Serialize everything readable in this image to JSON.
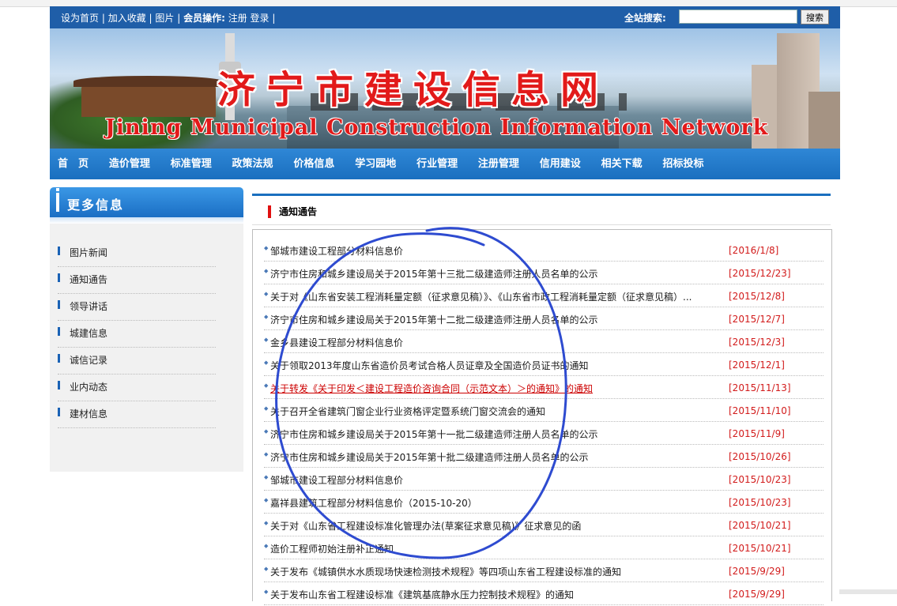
{
  "browser": {
    "bookmarks": [
      "",
      "",
      "",
      "",
      "",
      "",
      "",
      "",
      "",
      ""
    ]
  },
  "topbar": {
    "links": [
      "设为首页",
      "加入收藏",
      "图片"
    ],
    "member_label": "会员操作:",
    "member_links": [
      "注册",
      "登录"
    ],
    "search_label": "全站搜索:",
    "search_value": "",
    "search_button": "搜索"
  },
  "banner": {
    "title_cn": "济宁市建设信息网",
    "title_en": "Jining Municipal Construction Information Network"
  },
  "nav": {
    "items": [
      "首　页",
      "造价管理",
      "标准管理",
      "政策法规",
      "价格信息",
      "学习园地",
      "行业管理",
      "注册管理",
      "信用建设",
      "相关下载",
      "招标投标"
    ]
  },
  "sidebar": {
    "title": "更多信息",
    "items": [
      "图片新闻",
      "通知通告",
      "领导讲话",
      "城建信息",
      "诚信记录",
      "业内动态",
      "建材信息"
    ]
  },
  "main": {
    "title": "通知通告",
    "items": [
      {
        "title": "邹城市建设工程部分材料信息价",
        "date": "[2016/1/8]"
      },
      {
        "title": "济宁市住房和城乡建设局关于2015年第十三批二级建造师注册人员名单的公示",
        "date": "[2015/12/23]"
      },
      {
        "title": "关于对《山东省安装工程消耗量定额（征求意见稿）》、《山东省市政工程消耗量定额（征求意见稿）...",
        "date": "[2015/12/8]"
      },
      {
        "title": "济宁市住房和城乡建设局关于2015年第十二批二级建造师注册人员名单的公示",
        "date": "[2015/12/7]"
      },
      {
        "title": "金乡县建设工程部分材料信息价",
        "date": "[2015/12/3]"
      },
      {
        "title": "关于领取2013年度山东省造价员考试合格人员证章及全国造价员证书的通知",
        "date": "[2015/12/1]"
      },
      {
        "title": "关于转发《关于印发＜建设工程造价咨询合同（示范文本）＞的通知》的通知",
        "date": "[2015/11/13]"
      },
      {
        "title": "关于召开全省建筑门窗企业行业资格评定暨系统门窗交流会的通知",
        "date": "[2015/11/10]"
      },
      {
        "title": "济宁市住房和城乡建设局关于2015年第十一批二级建造师注册人员名单的公示",
        "date": "[2015/11/9]"
      },
      {
        "title": "济宁市住房和城乡建设局关于2015年第十批二级建造师注册人员名单的公示",
        "date": "[2015/10/26]"
      },
      {
        "title": "邹城市建设工程部分材料信息价",
        "date": "[2015/10/23]"
      },
      {
        "title": "嘉祥县建筑工程部分材料信息价（2015-10-20）",
        "date": "[2015/10/23]"
      },
      {
        "title": "关于对《山东省工程建设标准化管理办法(草案征求意见稿)》征求意见的函",
        "date": "[2015/10/21]"
      },
      {
        "title": "造价工程师初始注册补正通知",
        "date": "[2015/10/21]"
      },
      {
        "title": "关于发布《城镇供水水质现场快速检测技术规程》等四项山东省工程建设标准的通知",
        "date": "[2015/9/29]"
      },
      {
        "title": "关于发布山东省工程建设标准《建筑基底静水压力控制技术规程》的通知",
        "date": "[2015/9/29]"
      }
    ],
    "highlighted_index": 6
  },
  "colors": {
    "topbar": "#1f5ea8",
    "nav": "#1a6fbf",
    "date_red": "#d21b1b",
    "annotation": "#2e4bd0"
  }
}
